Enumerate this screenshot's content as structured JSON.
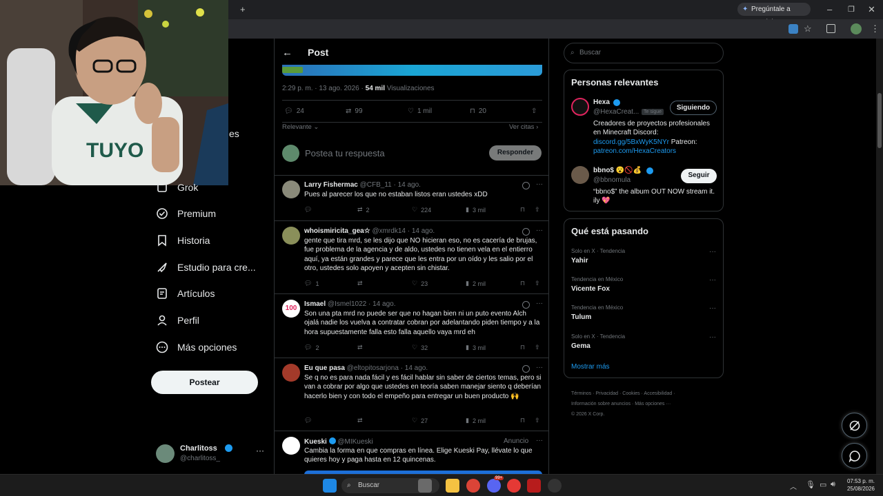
{
  "browser": {
    "gemini_label": "Pregúntale a Gemini",
    "new_tab": "+"
  },
  "nav": {
    "items": [
      {
        "label": "Grok",
        "icon": "grok-icon"
      },
      {
        "label": "Premium",
        "icon": "premium-icon"
      },
      {
        "label": "Historia",
        "icon": "bookmark-icon"
      },
      {
        "label": "Estudio para cre...",
        "icon": "rocket-icon"
      },
      {
        "label": "Artículos",
        "icon": "article-icon"
      },
      {
        "label": "Perfil",
        "icon": "person-icon"
      },
      {
        "label": "Más opciones",
        "icon": "more-circle-icon"
      }
    ],
    "partial_label": "es",
    "post_button": "Postear",
    "account": {
      "name": "Charlitoss",
      "handle": "@charlitoss_"
    }
  },
  "post": {
    "header_title": "Post",
    "meta_time": "2:29 p. m. · 13 ago. 2026 ·",
    "views_count": "54 mil",
    "views_label": "Visualizaciones",
    "replies": "24",
    "reposts": "99",
    "likes": "1 mil",
    "bookmarks": "20",
    "sort_label": "Relevante",
    "quotes_link": "Ver citas",
    "reply_placeholder": "Postea tu respuesta",
    "reply_button": "Responder"
  },
  "tweets": [
    {
      "name": "Larry Fishermac",
      "handle": "@CFB_11",
      "time": "· 14 ago.",
      "text": "Pues al parecer los que no estaban listos eran ustedes xDD",
      "replies": "",
      "reposts": "2",
      "likes": "224",
      "views": "3 mil"
    },
    {
      "name": "whoismiricita_gea☆",
      "handle": "@xmrdk14",
      "time": "· 14 ago.",
      "text": "gente que tira mrd, se les dijo que NO hicieran eso, no es cacería de brujas, fue problema de la agencia y de aldo, ustedes no tienen vela en el entierro aquí, ya están grandes y parece que les entra por un oído y les salio por el otro, ustedes solo apoyen y acepten sin chistar.",
      "replies": "1",
      "reposts": "",
      "likes": "23",
      "views": "2 mil"
    },
    {
      "name": "Ismael",
      "handle": "@Ismel1022",
      "time": "· 14 ago.",
      "text": "Son una pta mrd no puede ser que no hagan bien ni un puto evento Alch ojalá nadie los vuelva a contratar cobran por adelantando piden tiempo y a la hora supuestamente falla esto falla aquello vaya mrd eh",
      "replies": "2",
      "reposts": "",
      "likes": "32",
      "views": "3 mil"
    },
    {
      "name": "Eu que pasa",
      "handle": "@eltopitosarjona",
      "time": "· 14 ago.",
      "text": "Se q no es para nada fácil y es fácil hablar sin saber de ciertos temas, pero si van a cobrar por algo que ustedes en teoría saben manejar siento q deberían hacerlo bien y con todo el empeño para entregar un buen producto 🙌",
      "replies": "",
      "reposts": "",
      "likes": "27",
      "views": "2 mil"
    },
    {
      "name": "Kueski",
      "handle": "@MIKueski",
      "time": "",
      "ad_label": "Anuncio",
      "text": "Cambia la forma en que compras en línea. Elige Kueski Pay, llévate lo que quieres hoy y paga hasta en 12 quincenas."
    }
  ],
  "right": {
    "search_placeholder": "Buscar",
    "relevant_title": "Personas relevantes",
    "people": [
      {
        "name": "Hexa",
        "handle": "@HexaCreat...",
        "follows_you": "Te sigue",
        "button": "Siguiendo",
        "bio1": "Creadores de proyectos profesionales en Minecraft Discord:",
        "link1": "discord.gg/5BxWyK5NYr",
        "bio2": "Patreon:",
        "link2": "patreon.com/HexaCreators"
      },
      {
        "name": "bbno$ 😮🚫💰",
        "handle": "@bbnomula",
        "button": "Seguir",
        "bio1": "“bbno$” the album OUT NOW stream it. ily 💖"
      }
    ],
    "trends_title": "Qué está pasando",
    "trends": [
      {
        "context": "Solo en X · Tendencia",
        "name": "Yahir"
      },
      {
        "context": "Tendencia en México",
        "name": "Vicente Fox"
      },
      {
        "context": "Tendencia en México",
        "name": "Tulum"
      },
      {
        "context": "Solo en X · Tendencia",
        "name": "Gema"
      }
    ],
    "show_more": "Mostrar más",
    "footer1": "Términos · Privacidad · Cookies · Accesibilidad ·",
    "footer2": "Información sobre anuncios · Más opciones ···",
    "footer3": "© 2026 X Corp."
  },
  "taskbar": {
    "search_label": "Buscar",
    "time": "07:53 p. m.",
    "date": "25/08/2026",
    "badge": "99+"
  },
  "colors": {
    "accent": "#1d9bf0",
    "bg": "#000000",
    "border": "#2f3336",
    "muted": "#71767b"
  }
}
